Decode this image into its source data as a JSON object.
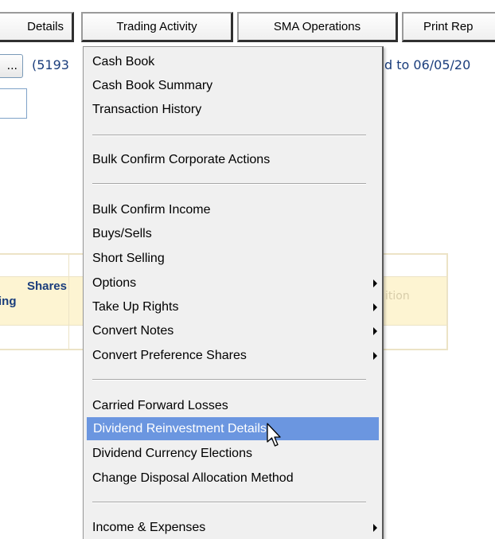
{
  "tabs": [
    {
      "label": "Details"
    },
    {
      "label": "Trading Activity"
    },
    {
      "label": "SMA Operations"
    },
    {
      "label": "Print Rep"
    }
  ],
  "background": {
    "button_label": "...",
    "code_text": "(5193",
    "date_text": "d to 06/05/20",
    "grid_header_line1": "Shares",
    "grid_header_line2": "ing",
    "grid_faded_text": "ition"
  },
  "menu": {
    "items": [
      {
        "label": "Cash Book"
      },
      {
        "label": "Cash Book Summary"
      },
      {
        "label": "Transaction History"
      },
      {
        "label": "Bulk Confirm Corporate Actions"
      },
      {
        "label": "Bulk Confirm Income"
      },
      {
        "label": "Buys/Sells"
      },
      {
        "label": "Short Selling"
      },
      {
        "label": "Options",
        "submenu": true
      },
      {
        "label": "Take Up Rights",
        "submenu": true
      },
      {
        "label": "Convert Notes",
        "submenu": true
      },
      {
        "label": "Convert Preference Shares",
        "submenu": true
      },
      {
        "label": "Carried Forward Losses"
      },
      {
        "label": "Dividend Reinvestment Details",
        "highlighted": true
      },
      {
        "label": "Dividend Currency Elections"
      },
      {
        "label": "Change Disposal Allocation Method"
      },
      {
        "label": "Income & Expenses",
        "submenu": true
      }
    ]
  },
  "colors": {
    "highlight": "#6b96e0",
    "menu_background": "#f0f0f0",
    "link_text": "#1a3d7c",
    "grid_header": "#fdf4d2"
  },
  "icons": {
    "submenu_arrow": "triangle-right-icon",
    "cursor": "mouse-pointer-icon"
  }
}
